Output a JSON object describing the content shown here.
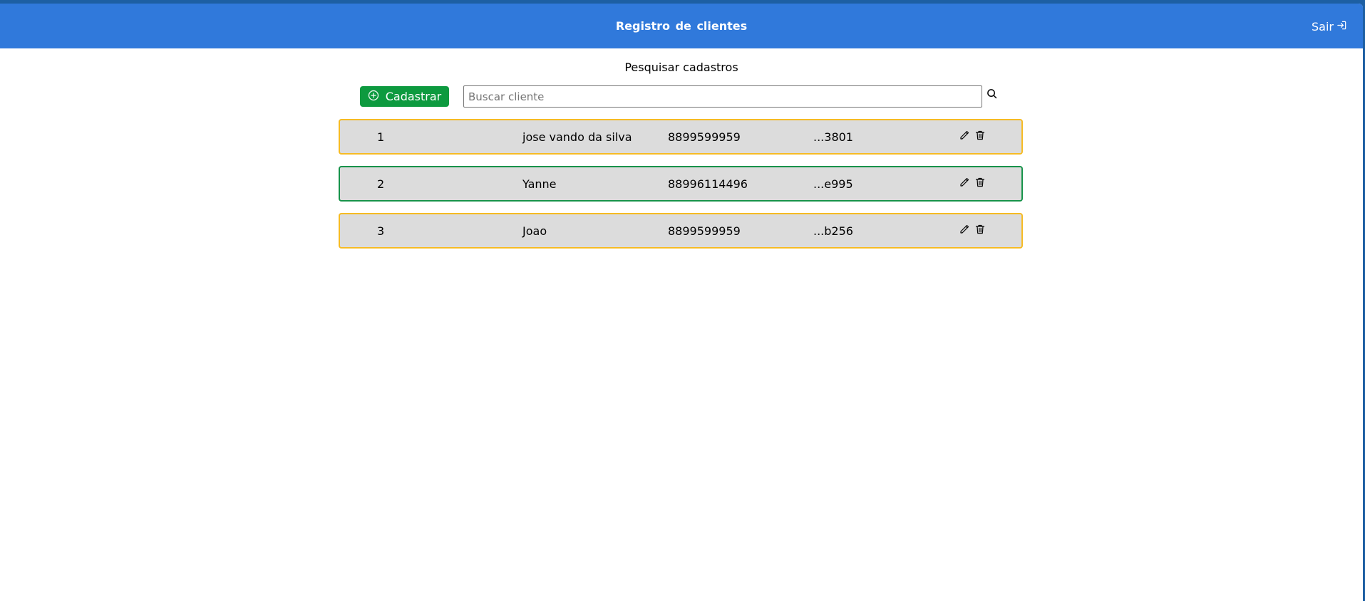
{
  "header": {
    "title": "Registro de clientes",
    "logout_label": "Sair",
    "logout_icon": "logout-icon"
  },
  "search": {
    "title": "Pesquisar cadastros",
    "placeholder": "Buscar cliente",
    "value": "",
    "search_icon": "search-icon"
  },
  "toolbar": {
    "add_label": "Cadastrar",
    "add_icon": "plus-circle-icon"
  },
  "clients": [
    {
      "id": "1",
      "name": "jose vando da silva",
      "phone": "8899599959",
      "code": "...3801",
      "border": "#f6bb24"
    },
    {
      "id": "2",
      "name": "Yanne",
      "phone": "88996114496",
      "code": "...e995",
      "border": "#17934a"
    },
    {
      "id": "3",
      "name": "Joao",
      "phone": "8899599959",
      "code": "...b256",
      "border": "#f6bb24"
    }
  ],
  "row_actions": {
    "edit_icon": "pencil-icon",
    "delete_icon": "trash-icon"
  },
  "colors": {
    "header": "#3079db",
    "add_button": "#0d9a3f",
    "row_background": "#dcdcdc",
    "row_border_default": "#f6bb24",
    "row_border_selected": "#17934a"
  }
}
